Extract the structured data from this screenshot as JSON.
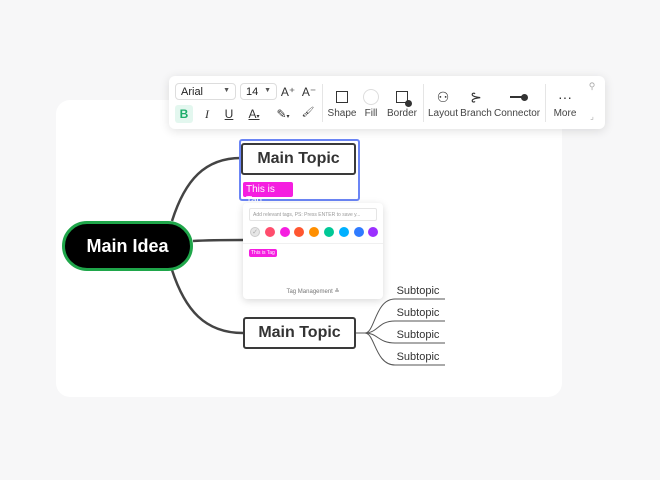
{
  "toolbar": {
    "font": "Arial",
    "size": "14",
    "increase_font": "A⁺",
    "decrease_font": "A⁻",
    "bold": "B",
    "italic": "I",
    "underline": "U",
    "font_color": "A",
    "highlight": "✎",
    "format_painter": "🖌",
    "shape": "Shape",
    "fill": "Fill",
    "border": "Border",
    "layout": "Layout",
    "branch": "Branch",
    "connector": "Connector",
    "more": "More"
  },
  "mindmap": {
    "main_idea": "Main Idea",
    "topics": [
      "Main Topic",
      "Main Topic"
    ],
    "tag": "This is Tag",
    "subtopics": [
      "Subtopic",
      "Subtopic",
      "Subtopic",
      "Subtopic"
    ]
  },
  "tag_popup": {
    "placeholder": "Add relevant tags, PS: Press ENTER to save y...",
    "colors": [
      "#e6e6e6",
      "#ff4d6d",
      "#f51ee0",
      "#ff5630",
      "#ff8f00",
      "#00c896",
      "#00b0ff",
      "#2f7bff",
      "#9b30ff"
    ],
    "existing_tag": "This is Tag",
    "management": "Tag Management ≚"
  },
  "colors": {
    "selection": "#6b85f5",
    "main_idea_border": "#1fa64a",
    "tag": "#f51ee0"
  }
}
